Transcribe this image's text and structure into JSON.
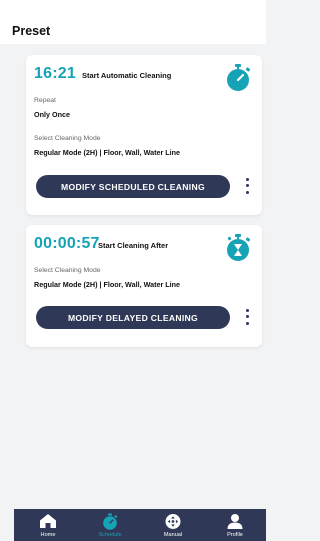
{
  "header": {
    "title": "Preset"
  },
  "cards": [
    {
      "time": "16:21",
      "caption": "Start Automatic Cleaning",
      "repeat_label": "Repeat",
      "repeat_value": "Only Once",
      "mode_label": "Select Cleaning Mode",
      "mode_value": "Regular Mode (2H) | Floor, Wall, Water Line",
      "button_label": "MODIFY SCHEDULED CLEANING",
      "icon": "stopwatch-icon"
    },
    {
      "time": "00:00:57",
      "caption": "Start Cleaning After",
      "mode_label": "Select Cleaning Mode",
      "mode_value": "Regular Mode (2H) | Floor, Wall, Water Line",
      "button_label": "MODIFY DELAYED CLEANING",
      "icon": "hourglass-timer-icon"
    }
  ],
  "tabs": [
    {
      "label": "Home",
      "icon": "home-icon",
      "active": false
    },
    {
      "label": "Schedule",
      "icon": "schedule-icon",
      "active": true
    },
    {
      "label": "Manual",
      "icon": "gamepad-icon",
      "active": false
    },
    {
      "label": "Profile",
      "icon": "profile-icon",
      "active": false
    }
  ],
  "colors": {
    "accent": "#15a3b5",
    "dark": "#2f3856",
    "background": "#f2f3f5"
  }
}
